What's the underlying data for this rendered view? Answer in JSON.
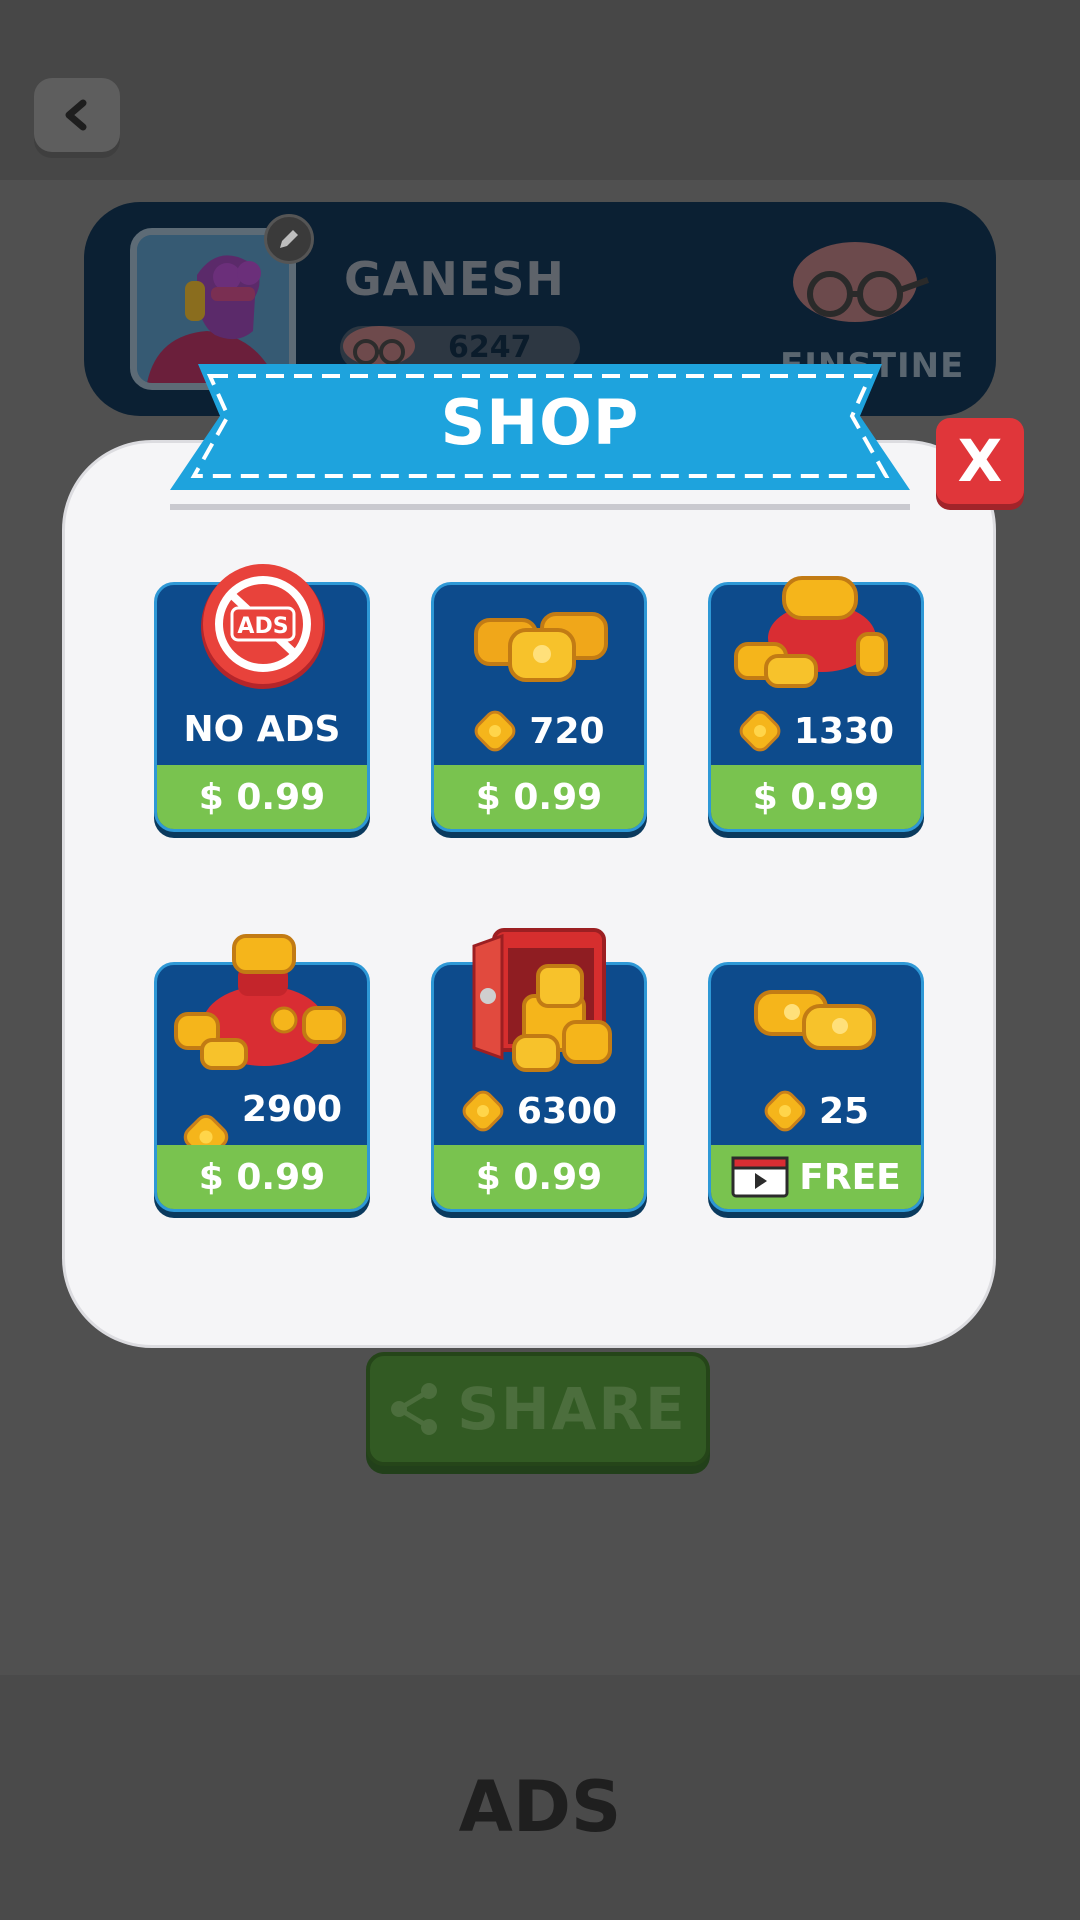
{
  "background": {
    "player": {
      "name": "GANESH",
      "score": "6247",
      "rank": "EINSTINE"
    },
    "share_label": "SHARE",
    "ads_label": "ADS"
  },
  "shop": {
    "title": "SHOP",
    "close_label": "X",
    "items": [
      {
        "id": "no-ads",
        "label": "NO ADS",
        "price": "$ 0.99",
        "art": "no-ads-icon"
      },
      {
        "id": "coins-720",
        "amount": "720",
        "price": "$ 0.99",
        "art": "coin-pile-icon"
      },
      {
        "id": "coins-1330",
        "amount": "1330",
        "price": "$ 0.99",
        "art": "coin-purse-icon"
      },
      {
        "id": "coins-2900",
        "amount": "2900",
        "price": "$ 0.99",
        "art": "coin-bag-icon"
      },
      {
        "id": "coins-6300",
        "amount": "6300",
        "price": "$ 0.99",
        "art": "coin-safe-icon"
      },
      {
        "id": "coins-25",
        "amount": "25",
        "price": "FREE",
        "art": "video-ad-icon"
      }
    ]
  },
  "colors": {
    "card_blue": "#0d4b8c",
    "price_green": "#79c34f",
    "banner_blue": "#1ea3dd",
    "close_red": "#e0363a"
  }
}
